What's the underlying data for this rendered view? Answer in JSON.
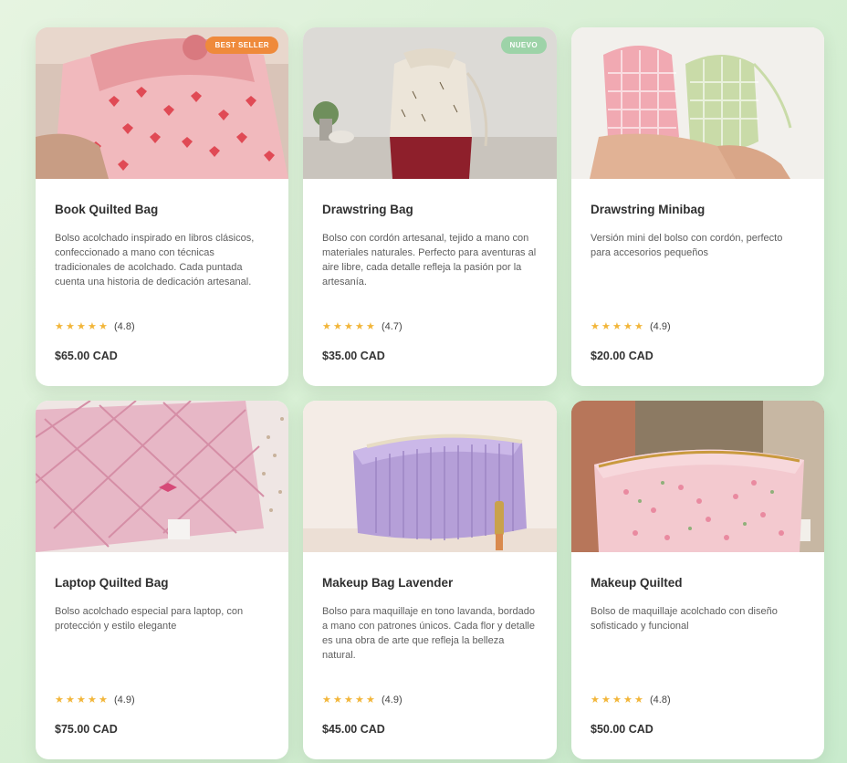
{
  "products": [
    {
      "title": "Book Quilted Bag",
      "badge": "BEST SELLER",
      "description": "Bolso acolchado inspirado en libros clásicos, confeccionado a mano con técnicas tradicionales de acolchado. Cada puntada cuenta una historia de dedicación artesanal.",
      "rating_text": "(4.8)",
      "rating": 4.8,
      "price": "$65.00 CAD"
    },
    {
      "title": "Drawstring Bag",
      "badge": "NUEVO",
      "description": "Bolso con cordón artesanal, tejido a mano con materiales naturales. Perfecto para aventuras al aire libre, cada detalle refleja la pasión por la artesanía.",
      "rating_text": "(4.7)",
      "rating": 4.7,
      "price": "$35.00 CAD"
    },
    {
      "title": "Drawstring Minibag",
      "badge": "",
      "description": "Versión mini del bolso con cordón, perfecto para accesorios pequeños",
      "rating_text": "(4.9)",
      "rating": 4.9,
      "price": "$20.00 CAD"
    },
    {
      "title": "Laptop Quilted Bag",
      "badge": "",
      "description": "Bolso acolchado especial para laptop, con protección y estilo elegante",
      "rating_text": "(4.9)",
      "rating": 4.9,
      "price": "$75.00 CAD"
    },
    {
      "title": "Makeup Bag Lavender",
      "badge": "",
      "description": "Bolso para maquillaje en tono lavanda, bordado a mano con patrones únicos. Cada flor y detalle es una obra de arte que refleja la belleza natural.",
      "rating_text": "(4.9)",
      "rating": 4.9,
      "price": "$45.00 CAD"
    },
    {
      "title": "Makeup Quilted",
      "badge": "",
      "description": "Bolso de maquillaje acolchado con diseño sofisticado y funcional",
      "rating_text": "(4.8)",
      "rating": 4.8,
      "price": "$50.00 CAD"
    }
  ],
  "colors": {
    "star": "#f2b63a",
    "badge_best_seller": "#ef8a3b",
    "badge_new": "#9dd3a8"
  },
  "icons": {
    "star": "star-icon"
  }
}
